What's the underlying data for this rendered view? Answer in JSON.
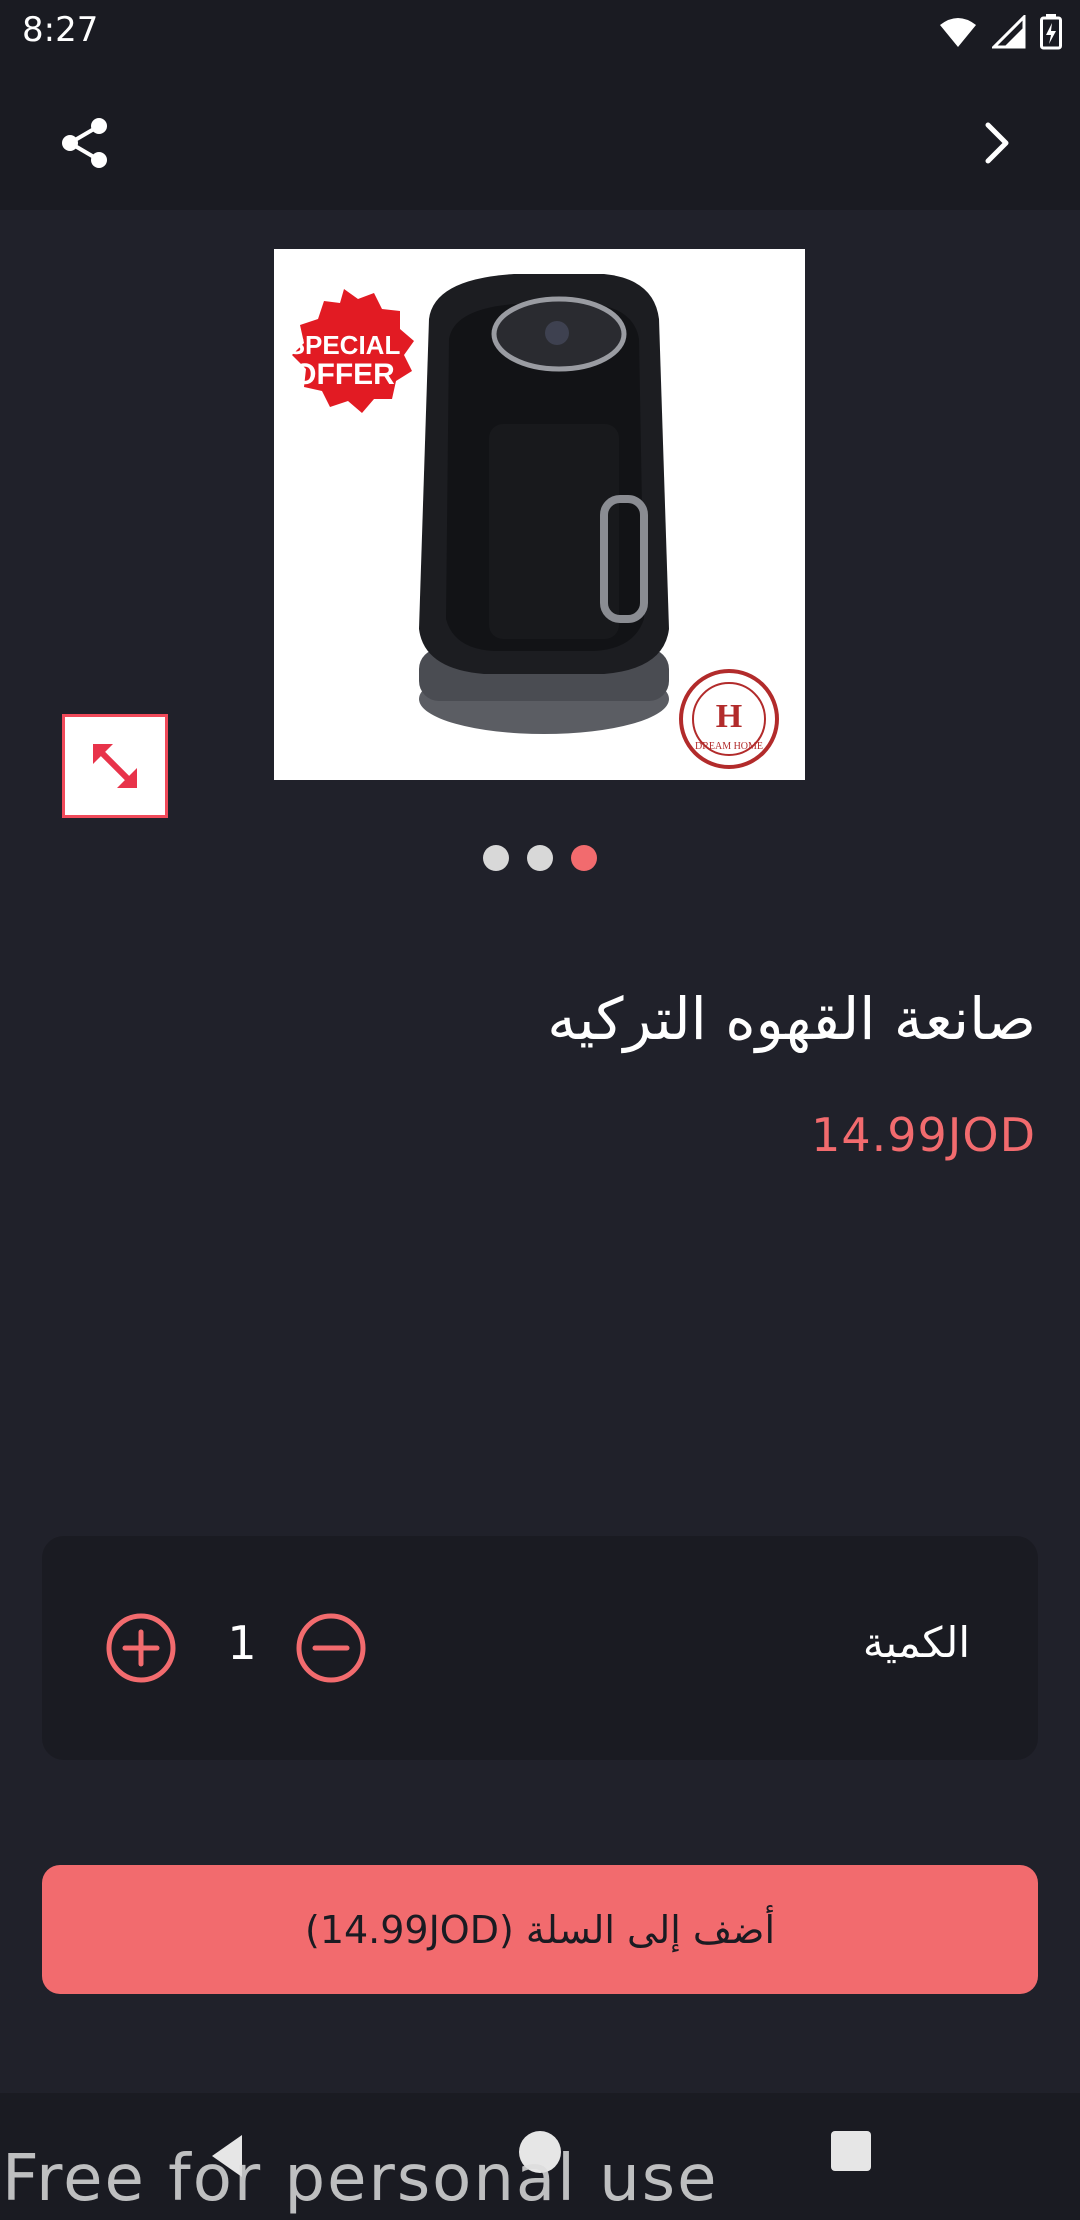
{
  "status_bar": {
    "time": "8:27"
  },
  "product": {
    "title": "صانعة القهوه التركيه",
    "price": "14.99JOD",
    "image": {
      "badge_line1": "SPECIAL",
      "badge_line2": "OFFER",
      "brand_text": "DREAM HOME"
    },
    "gallery": {
      "count": 3,
      "active_index": 2
    }
  },
  "quantity": {
    "label": "الكمية",
    "value": "1"
  },
  "add_to_cart": {
    "label": "أضف إلى السلة (14.99JOD)"
  },
  "watermark": "Free for personal use",
  "colors": {
    "accent": "#f26b6e",
    "background": "#20212a",
    "bar": "#1a1b22"
  }
}
